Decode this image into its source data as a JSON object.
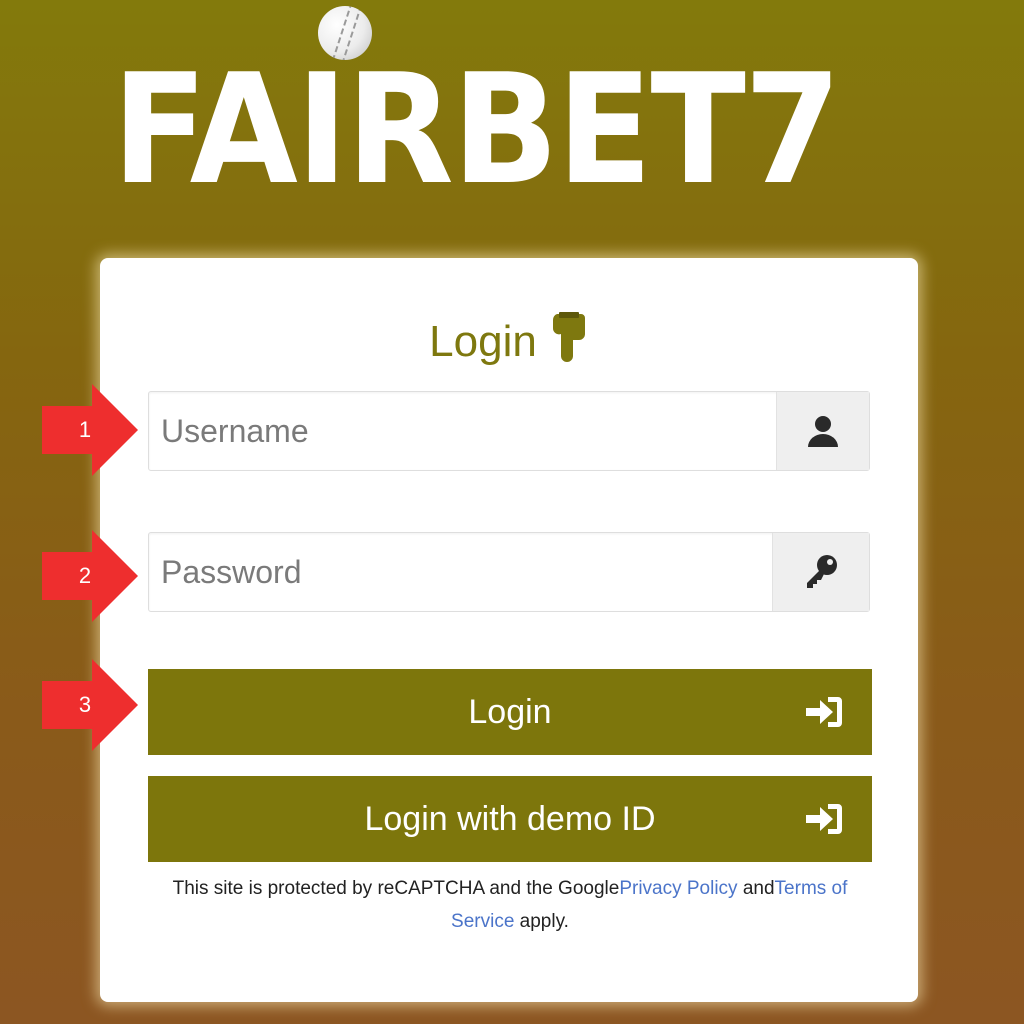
{
  "brand": {
    "logo_text": "FAIRBET7"
  },
  "login_form": {
    "title": "Login",
    "username": {
      "placeholder": "Username",
      "value": ""
    },
    "password": {
      "placeholder": "Password",
      "value": ""
    },
    "login_button_label": "Login",
    "demo_button_label": "Login with demo ID",
    "captcha": {
      "prefix": "This site is protected by reCAPTCHA and the Google",
      "privacy_link": "Privacy Policy",
      "middle": " and",
      "terms_link": "Terms of Service",
      "suffix": " apply."
    }
  },
  "annotations": {
    "step_1": "1",
    "step_2": "2",
    "step_3": "3"
  },
  "icons": {
    "title": "hand-pointing-down-icon",
    "username": "user-icon",
    "password": "key-icon",
    "buttons": "sign-in-icon"
  },
  "colors": {
    "accent": "#7d760c",
    "background_top": "#837a0c",
    "background_bottom": "#8c5622",
    "link": "#4b74c9",
    "arrow": "#ee2e2e"
  }
}
